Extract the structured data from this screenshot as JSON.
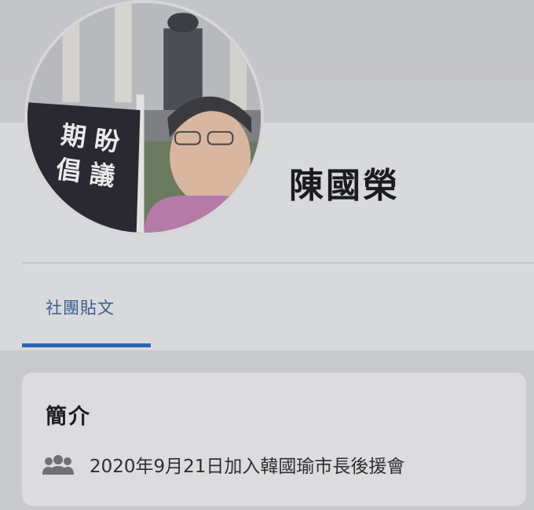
{
  "profile": {
    "name": "陳國榮",
    "avatar_alt": "profile photo",
    "avatar_banner_text": [
      "期",
      "盼",
      "倡",
      "議"
    ]
  },
  "tabs": [
    {
      "label": "社團貼文",
      "active": true
    }
  ],
  "about": {
    "title": "簡介",
    "joined_text": "2020年9月21日加入韓國瑜市長後援會",
    "icon": "group-icon"
  },
  "colors": {
    "accent": "#2f66b3",
    "tab_text": "#3b5b8a",
    "background": "#c8c9cc"
  }
}
